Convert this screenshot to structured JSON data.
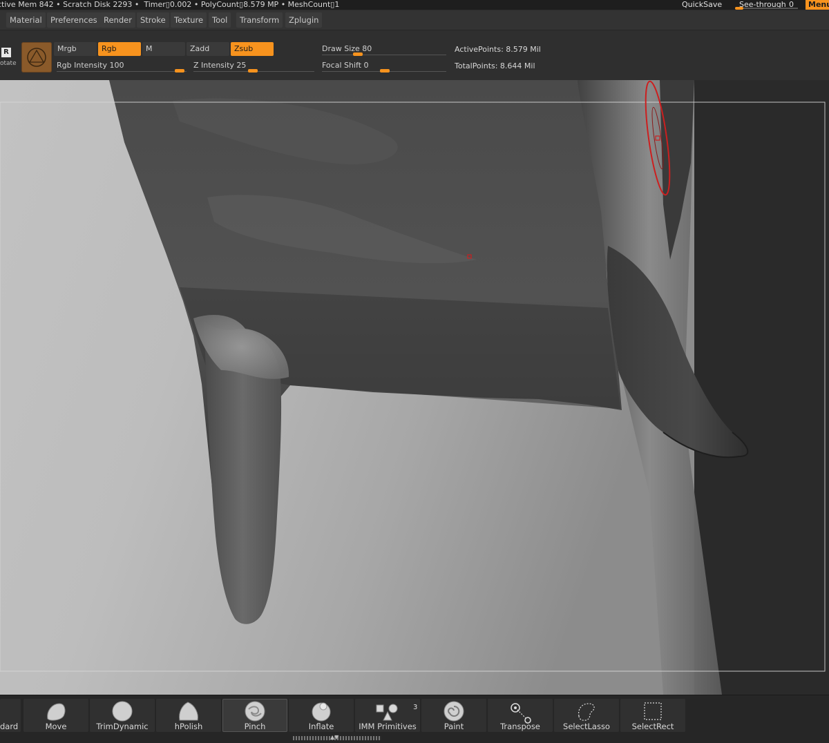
{
  "status_bar": {
    "text": "ctive Mem 842 • Scratch Disk 2293 •  Timer▯0.002 • PolyCount▯8.579 MP • MeshCount▯1",
    "quicksave": "QuickSave",
    "see_through_label": "See-through",
    "see_through_value": "0",
    "menus": "Menus"
  },
  "menu_bar": {
    "items": [
      "Material",
      "Preferences",
      "Render",
      "Stroke",
      "Texture",
      "Tool",
      "Transform",
      "Zplugin"
    ]
  },
  "tool_strip": {
    "rotate_key": "R",
    "rotate_label": "otate",
    "mrgb": "Mrgb",
    "rgb": "Rgb",
    "m": "M",
    "zadd": "Zadd",
    "zsub": "Zsub",
    "rgb_intensity": "Rgb Intensity 100",
    "rgb_intensity_value": 100,
    "z_intensity": "Z Intensity 25",
    "z_intensity_value": 25,
    "draw_size": "Draw Size 80",
    "draw_size_value": 80,
    "focal_shift": "Focal Shift 0",
    "focal_shift_value": 0,
    "active_points": "ActivePoints: 8.579 Mil",
    "total_points": "TotalPoints: 8.644 Mil"
  },
  "brush_shelf": {
    "brushes": [
      {
        "label": "dard",
        "icon": "standard-brush-icon"
      },
      {
        "label": "Move",
        "icon": "move-brush-icon"
      },
      {
        "label": "TrimDynamic",
        "icon": "trimdynamic-brush-icon"
      },
      {
        "label": "hPolish",
        "icon": "hpolish-brush-icon"
      },
      {
        "label": "Pinch",
        "icon": "pinch-brush-icon",
        "active": true
      },
      {
        "label": "Inflate",
        "icon": "inflate-brush-icon"
      },
      {
        "label": "IMM Primitives",
        "icon": "imm-primitives-icon",
        "badge": "3"
      },
      {
        "label": "Paint",
        "icon": "paint-brush-icon"
      },
      {
        "label": "Transpose",
        "icon": "transpose-icon"
      },
      {
        "label": "SelectLasso",
        "icon": "selectlasso-icon"
      },
      {
        "label": "SelectRect",
        "icon": "selectrect-icon"
      }
    ]
  },
  "colors": {
    "accent": "#f7931e",
    "panel": "#2f2f2f",
    "brush_cursor": "#cc1f1f"
  }
}
